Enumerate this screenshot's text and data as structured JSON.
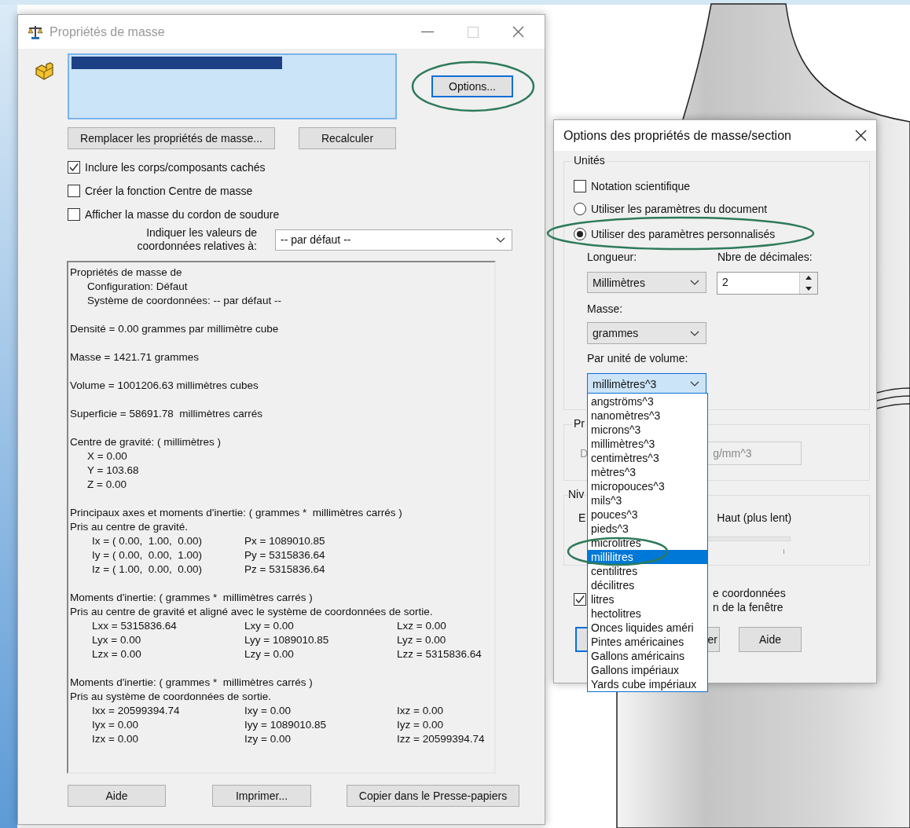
{
  "main_window": {
    "title": "Propriétés de masse",
    "options_button": "Options...",
    "replace_button": "Remplacer les propriétés de masse...",
    "recalc_button": "Recalculer",
    "checkboxes": [
      {
        "label": "Inclure les corps/composants cachés",
        "checked": true
      },
      {
        "label": "Créer la fonction Centre de masse",
        "checked": false
      },
      {
        "label": "Afficher la masse du cordon de soudure",
        "checked": false
      }
    ],
    "relative_label_lines": [
      "Indiquer les valeurs de",
      "coordonnées relatives à:"
    ],
    "relative_select": "-- par défaut --",
    "report": [
      {
        "lines": [
          {
            "text": "Propriétés de masse de",
            "children": [
              {
                "text": "Configuration: Défaut"
              },
              {
                "text": "Système de coordonnées: -- par défaut --"
              }
            ]
          }
        ]
      },
      {
        "lines": [
          {
            "text": "Densité = 0.00 grammes par millimètre cube"
          }
        ]
      },
      {
        "lines": [
          {
            "text": "Masse = 1421.71 grammes"
          }
        ]
      },
      {
        "lines": [
          {
            "text": "Volume = 1001206.63 millimètres cubes"
          }
        ]
      },
      {
        "lines": [
          {
            "text": "Superficie = 58691.78  millimètres carrés"
          }
        ]
      },
      {
        "lines": [
          {
            "text": "Centre de gravité: ( millimètres )",
            "children": [
              {
                "text": "X = 0.00"
              },
              {
                "text": "Y = 103.68"
              },
              {
                "text": "Z = 0.00"
              }
            ]
          }
        ]
      },
      {
        "lines": [
          {
            "text": "Principaux axes et moments d'inertie: ( grammes *  millimètres carrés )"
          },
          {
            "text": "Pris au centre de gravité."
          }
        ],
        "table": [
          [
            "Ix = ( 0.00,  1.00,  0.00)",
            "Px = 1089010.85"
          ],
          [
            "Iy = ( 0.00,  0.00,  1.00)",
            "Py = 5315836.64"
          ],
          [
            "Iz = ( 1.00,  0.00,  0.00)",
            "Pz = 5315836.64"
          ]
        ]
      },
      {
        "lines": [
          {
            "text": "Moments d'inertie: ( grammes *  millimètres carrés )"
          },
          {
            "text": "Pris au centre de gravité et aligné avec le système de coordonnées de sortie."
          }
        ],
        "table": [
          [
            "Lxx = 5315836.64",
            "Lxy = 0.00",
            "Lxz = 0.00"
          ],
          [
            "Lyx = 0.00",
            "Lyy = 1089010.85",
            "Lyz = 0.00"
          ],
          [
            "Lzx = 0.00",
            "Lzy = 0.00",
            "Lzz = 5315836.64"
          ]
        ]
      },
      {
        "lines": [
          {
            "text": "Moments d'inertie: ( grammes *  millimètres carrés )"
          },
          {
            "text": "Pris au système de coordonnées de sortie."
          }
        ],
        "table": [
          [
            "Ixx = 20599394.74",
            "Ixy = 0.00",
            "Ixz = 0.00"
          ],
          [
            "Iyx = 0.00",
            "Iyy = 1089010.85",
            "Iyz = 0.00"
          ],
          [
            "Izx = 0.00",
            "Izy = 0.00",
            "Izz = 20599394.74"
          ]
        ]
      }
    ],
    "bottom_buttons": [
      "Aide",
      "Imprimer...",
      "Copier dans le Presse-papiers"
    ]
  },
  "options_dialog": {
    "title": "Options des propriétés de masse/section",
    "units_group": "Unités",
    "scientific_notation": {
      "label": "Notation scientifique",
      "checked": false
    },
    "radios": [
      {
        "label": "Utiliser les paramètres du document",
        "selected": false
      },
      {
        "label": "Utiliser des paramètres personnalisés",
        "selected": true
      }
    ],
    "length_label": "Longueur:",
    "length_select": "Millimètres",
    "decimals_label": "Nbre de décimales:",
    "decimals_value": "2",
    "mass_label": "Masse:",
    "mass_select": "grammes",
    "volume_label": "Par unité de volume:",
    "volume_select": "millimètres^3",
    "volume_options": [
      {
        "label": "angströms^3",
        "selected": false
      },
      {
        "label": "nanomètres^3",
        "selected": false
      },
      {
        "label": "microns^3",
        "selected": false
      },
      {
        "label": "millimètres^3",
        "selected": false
      },
      {
        "label": "centimètres^3",
        "selected": false
      },
      {
        "label": "mètres^3",
        "selected": false
      },
      {
        "label": "micropouces^3",
        "selected": false
      },
      {
        "label": "mils^3",
        "selected": false
      },
      {
        "label": "pouces^3",
        "selected": false
      },
      {
        "label": "pieds^3",
        "selected": false
      },
      {
        "label": "microlitres",
        "selected": false
      },
      {
        "label": "millilitres",
        "selected": true
      },
      {
        "label": "centilitres",
        "selected": false
      },
      {
        "label": "décilitres",
        "selected": false
      },
      {
        "label": "litres",
        "selected": false
      },
      {
        "label": "hectolitres",
        "selected": false
      },
      {
        "label": "Onces liquides améri",
        "selected": false
      },
      {
        "label": "Pintes américaines",
        "selected": false
      },
      {
        "label": "Gallons américains",
        "selected": false
      },
      {
        "label": "Gallons impériaux",
        "selected": false
      },
      {
        "label": "Yards cube impériaux",
        "selected": false
      }
    ],
    "density_group": "Pr",
    "density_label": "D",
    "density_value": "g/mm^3",
    "accuracy_group": "Niv",
    "accuracy_low_label": "E",
    "accuracy_high_label": "Haut (plus lent)",
    "bottom_checkbox": {
      "label_lines": [
        "e coordonnées",
        "n de la fenêtre"
      ],
      "checked": true
    },
    "buttons": [
      "er",
      "Aide"
    ]
  }
}
